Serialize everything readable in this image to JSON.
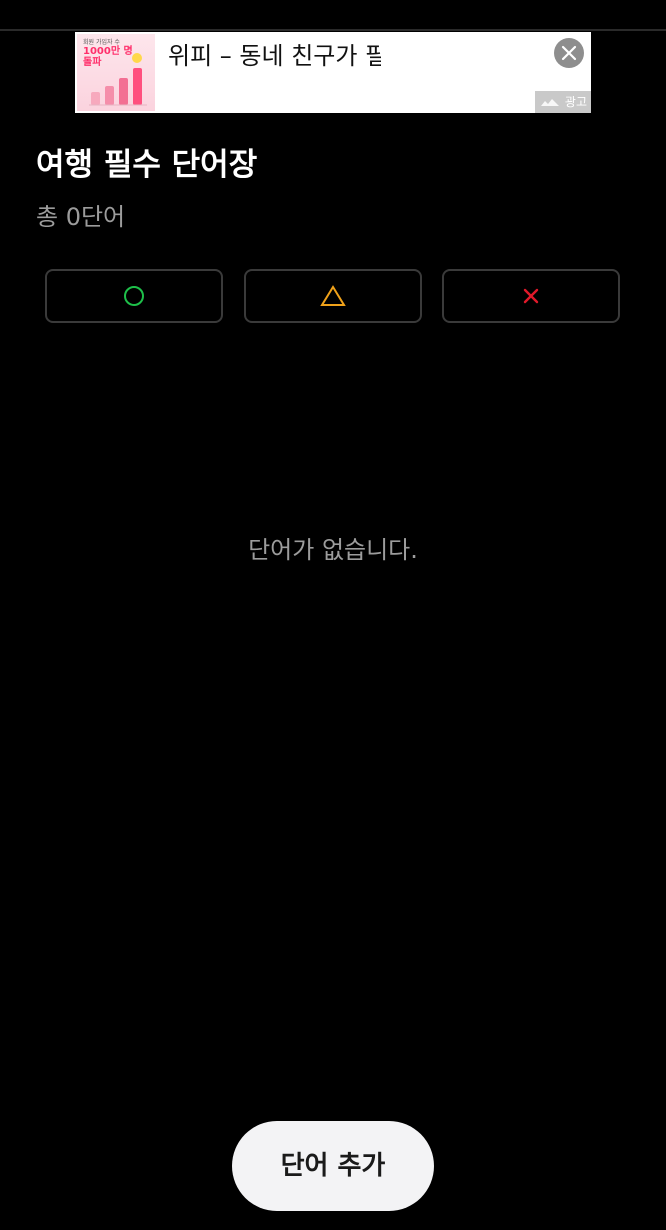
{
  "ad": {
    "thumb_caption": "회원 가입자 수",
    "thumb_headline_line1": "1000만 명",
    "thumb_headline_line2": "돌파",
    "title": "위피 – 동네 친구가 필",
    "label": "광고",
    "close_icon": "close-icon",
    "accent_color": "#ff2f6b"
  },
  "header": {
    "title": "여행 필수 단어장",
    "count_text": "총 0단어"
  },
  "filters": [
    {
      "name": "correct",
      "icon": "circle-icon",
      "color": "#1ec04a"
    },
    {
      "name": "unsure",
      "icon": "triangle-icon",
      "color": "#f0a21a"
    },
    {
      "name": "wrong",
      "icon": "x-icon",
      "color": "#e0192a"
    }
  ],
  "empty_state": {
    "message": "단어가 없습니다."
  },
  "actions": {
    "add_word_label": "단어 추가"
  }
}
